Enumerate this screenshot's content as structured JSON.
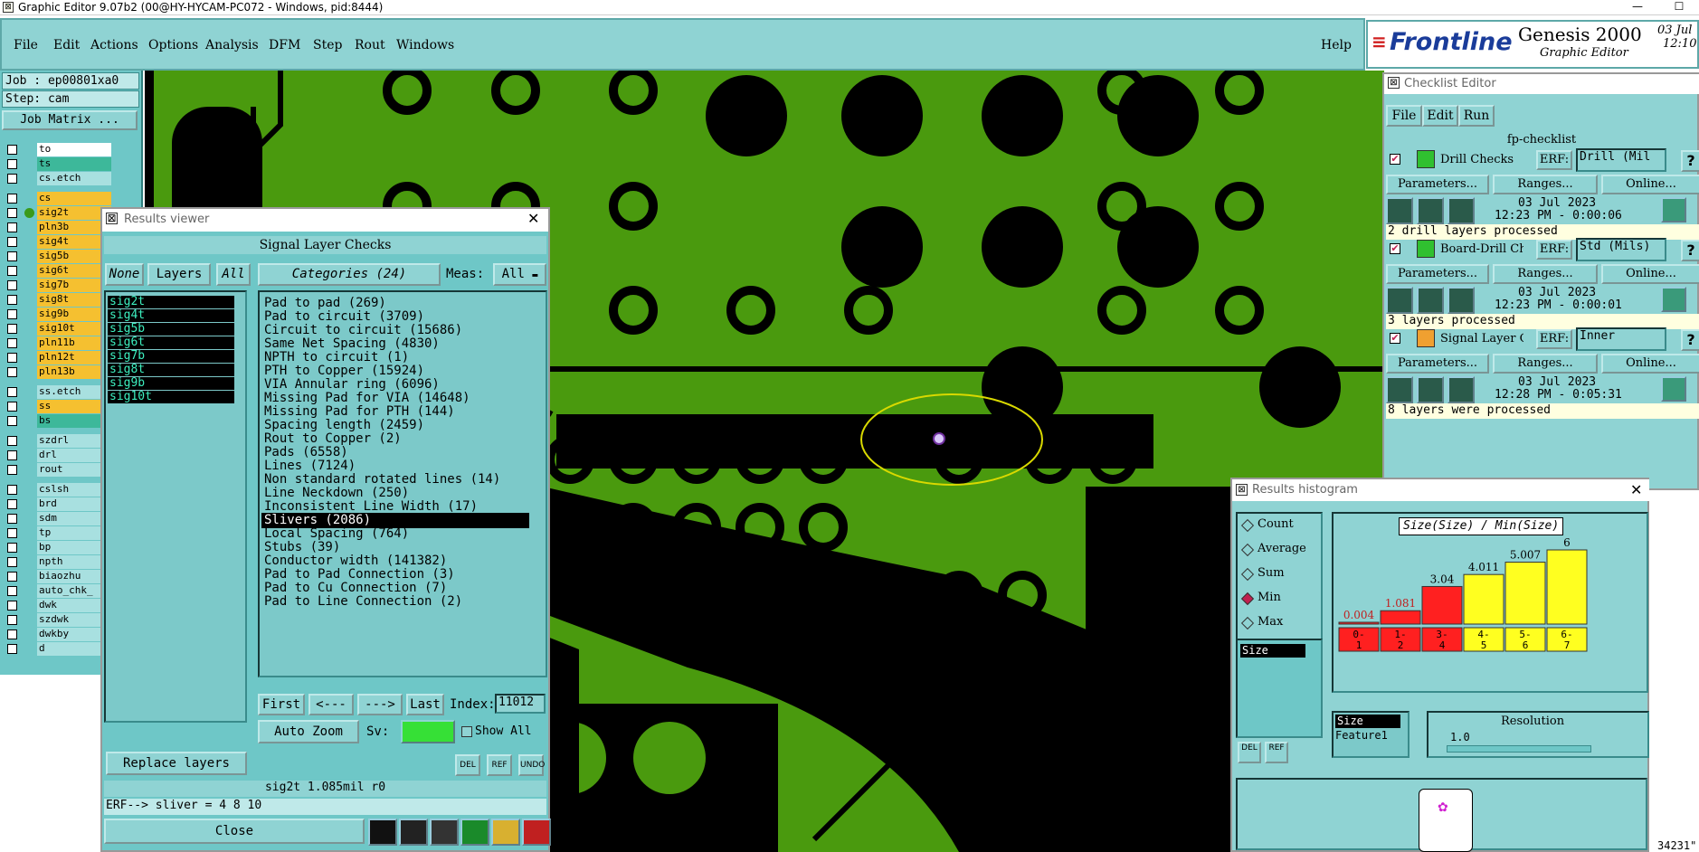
{
  "window": {
    "title": "Graphic Editor 9.07b2 (00@HY-HYCAM-PC072 - Windows, pid:8444)",
    "minimize": "—",
    "maximize": "☐"
  },
  "menu": {
    "items": [
      "File",
      "Edit",
      "Actions",
      "Options",
      "Analysis",
      "DFM",
      "Step",
      "Rout",
      "Windows"
    ],
    "help": "Help"
  },
  "brand": {
    "logo": "Frontline",
    "product": "Genesis 2000",
    "subtitle": "Graphic Editor",
    "date": "03 Jul",
    "time": "12:10"
  },
  "job": {
    "job": "Job : ep00801xa0",
    "step": "Step: cam",
    "matrix_button": "Job Matrix ..."
  },
  "layers": [
    {
      "name": "to",
      "color": "#ffffff"
    },
    {
      "name": "ts",
      "color": "#3db89a"
    },
    {
      "name": "cs.etch",
      "color": "#a8e0e0"
    },
    {
      "name": "cs",
      "color": "#f5c030"
    },
    {
      "name": "sig2t",
      "color": "#f5c030"
    },
    {
      "name": "pln3b",
      "color": "#f5c030"
    },
    {
      "name": "sig4t",
      "color": "#f5c030"
    },
    {
      "name": "sig5b",
      "color": "#f5c030"
    },
    {
      "name": "sig6t",
      "color": "#f5c030"
    },
    {
      "name": "sig7b",
      "color": "#f5c030"
    },
    {
      "name": "sig8t",
      "color": "#f5c030"
    },
    {
      "name": "sig9b",
      "color": "#f5c030"
    },
    {
      "name": "sig10t",
      "color": "#f5c030"
    },
    {
      "name": "pln11b",
      "color": "#f5c030"
    },
    {
      "name": "pln12t",
      "color": "#f5c030"
    },
    {
      "name": "pln13b",
      "color": "#f5c030"
    },
    {
      "name": "ss.etch",
      "color": "#a8e0e0"
    },
    {
      "name": "ss",
      "color": "#f5c030"
    },
    {
      "name": "bs",
      "color": "#3db89a"
    },
    {
      "name": "szdrl",
      "color": "#a8e0e0"
    },
    {
      "name": "drl",
      "color": "#a8e0e0"
    },
    {
      "name": "rout",
      "color": "#a8e0e0"
    },
    {
      "name": "cslsh",
      "color": "#a8e0e0"
    },
    {
      "name": "brd",
      "color": "#a8e0e0"
    },
    {
      "name": "sdm",
      "color": "#a8e0e0"
    },
    {
      "name": "tp",
      "color": "#a8e0e0"
    },
    {
      "name": "bp",
      "color": "#a8e0e0"
    },
    {
      "name": "npth",
      "color": "#a8e0e0"
    },
    {
      "name": "biaozhu",
      "color": "#a8e0e0"
    },
    {
      "name": "auto_chk_",
      "color": "#a8e0e0"
    },
    {
      "name": "dwk",
      "color": "#a8e0e0"
    },
    {
      "name": "szdwk",
      "color": "#a8e0e0"
    },
    {
      "name": "dwkby",
      "color": "#a8e0e0"
    },
    {
      "name": "d",
      "color": "#a8e0e0"
    }
  ],
  "results_viewer": {
    "title": "Results viewer",
    "header": "Signal Layer Checks",
    "none_btn": "None",
    "layers_btn": "Layers",
    "all_btn": "All",
    "categories_label": "Categories (24)",
    "meas_label": "Meas:",
    "meas_value": "All",
    "layer_list": [
      "sig2t",
      "sig4t",
      "sig5b",
      "sig6t",
      "sig7b",
      "sig8t",
      "sig9b",
      "sig10t"
    ],
    "categories": [
      "Pad to pad (269)",
      "Pad to circuit (3709)",
      "Circuit to circuit (15686)",
      "Same Net Spacing (4830)",
      "NPTH to circuit (1)",
      "PTH to Copper (15924)",
      "VIA Annular ring (6096)",
      "Missing Pad for VIA (14648)",
      "Missing Pad for PTH (144)",
      "Spacing length (2459)",
      "Rout to Copper (2)",
      "Pads (6558)",
      "Lines (7124)",
      "Non standard rotated lines (14)",
      "Line Neckdown (250)",
      "Inconsistent Line Width (17)",
      "Slivers (2086)",
      "Local Spacing (764)",
      "Stubs (39)",
      "Conductor width (141382)",
      "Pad to Pad Connection (3)",
      "Pad to Cu Connection (7)",
      "Pad to Line Connection (2)"
    ],
    "selected_category": "Slivers (2086)",
    "first": "First",
    "prev": "<---",
    "next": "--->",
    "last": "Last",
    "index_label": "Index:",
    "index_value": "11012",
    "auto_zoom": "Auto Zoom",
    "sv_label": "Sv:",
    "show_all": "Show All",
    "replace_layers": "Replace layers",
    "status": "sig2t 1.085mil  r0",
    "erf": "ERF--> sliver = 4 8 10",
    "close": "Close"
  },
  "checklist": {
    "title": "Checklist Editor",
    "menu": [
      "File",
      "Edit",
      "Run"
    ],
    "name": "fp-checklist",
    "checks": [
      {
        "name": "Drill Checks",
        "erf": "ERF:",
        "erf_value": "Drill (Mil",
        "date": "03 Jul 2023",
        "time": "12:23 PM - 0:00:06",
        "status": "2 drill layers processed"
      },
      {
        "name": "Board-Drill Che",
        "erf": "ERF:",
        "erf_value": "Std (Mils)",
        "date": "03 Jul 2023",
        "time": "12:23 PM - 0:00:01",
        "status": "3 layers processed"
      },
      {
        "name": "Signal Layer Ch",
        "erf": "ERF:",
        "erf_value": "Inner",
        "date": "03 Jul 2023",
        "time": "12:28 PM - 0:05:31",
        "status": "8 layers were processed"
      }
    ],
    "params": "Parameters...",
    "ranges": "Ranges...",
    "online": "Online...",
    "help": "?"
  },
  "histogram": {
    "title": "Results histogram",
    "options": [
      "Count",
      "Average",
      "Sum",
      "Min",
      "Max"
    ],
    "selected_option": "Min",
    "field_list": [
      "Size"
    ],
    "chart_title": "Size(Size) / Min(Size)",
    "bar_value_labels": [
      "0.004",
      "1.081",
      "3.04",
      "4.011",
      "5.007",
      "6"
    ],
    "bin_labels": [
      "0-\n1",
      "1-\n2",
      "3-\n4",
      "4-\n5",
      "5-\n6",
      "6-\n7"
    ],
    "red_color": "#ff2020",
    "yellow_color": "#ffff20",
    "list2": [
      "Size",
      "Feature1"
    ],
    "resolution_label": "Resolution",
    "resolution_value": "1.0",
    "del": "DEL",
    "ref": "REF",
    "footer_text": "34231\""
  },
  "chart_data": {
    "type": "bar",
    "title": "Size(Size) / Min(Size)",
    "categories": [
      "0-1",
      "1-2",
      "3-4",
      "4-5",
      "5-6",
      "6-7"
    ],
    "values": [
      0.004,
      1.081,
      3.04,
      4.011,
      5.007,
      6
    ],
    "ylim": [
      0,
      6
    ],
    "colors": [
      "#ff2020",
      "#ff2020",
      "#ff2020",
      "#ffff20",
      "#ffff20",
      "#ffff20"
    ]
  }
}
